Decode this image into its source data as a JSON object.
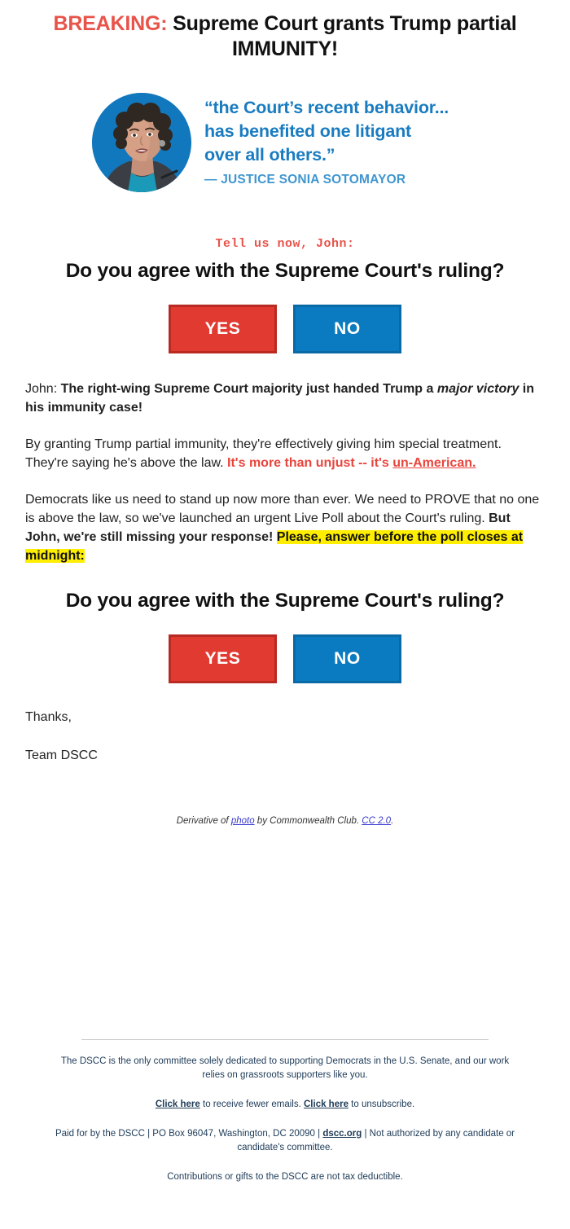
{
  "headline": {
    "breaking_label": "BREAKING:",
    "rest": " Supreme Court grants Trump partial IMMUNITY!"
  },
  "quote_card": {
    "portrait_alt": "Justice Sonia Sotomayor portrait",
    "lines": [
      "“the Court’s recent behavior...",
      "has benefited one litigant",
      "over all others.”"
    ],
    "attribution": "— JUSTICE SONIA SOTOMAYOR",
    "quote_color": "#1a7cc0",
    "attribution_color": "#3f96cf",
    "circle_color": "#1278be"
  },
  "poll": {
    "prompt": "Tell us now, John:",
    "question": "Do you agree with the Supreme Court's ruling?",
    "yes_label": "YES",
    "no_label": "NO",
    "yes_color": "#e03a31",
    "no_color": "#0a7bc0"
  },
  "body": {
    "p1_prefix": "John: ",
    "p1_bold_a": "The right-wing Supreme Court majority just handed Trump a ",
    "p1_italic": "major victory",
    "p1_bold_b": " in his immunity case!",
    "p2_plain": "By granting Trump partial immunity, they're effectively giving him special treatment. They're saying he's above the law. ",
    "p2_red_a": "It's more than unjust -- it's ",
    "p2_red_underline": "un-American.",
    "p3_plain": "Democrats like us need to stand up now more than ever. We need to PROVE that no one is above the law, so we've launched an urgent Live Poll about the Court's ruling. ",
    "p3_bold": "But John, we're still missing your response! ",
    "p3_highlight": "Please, answer before the poll closes at midnight:"
  },
  "signoff": {
    "line1": "Thanks,",
    "line2": "Team DSCC"
  },
  "photo_credit": {
    "prefix": "Derivative of ",
    "link_photo": "photo",
    "middle": " by Commonwealth Club. ",
    "link_license": "CC 2.0",
    "suffix": "."
  },
  "footer": {
    "mission": "The DSCC is the only committee solely dedicated to supporting Democrats in the U.S. Senate, and our work relies on grassroots supporters like you.",
    "fewer_link": "Click here",
    "fewer_rest": " to receive fewer emails. ",
    "unsub_link": "Click here",
    "unsub_rest": " to unsubscribe.",
    "paid_prefix": "Paid for by the DSCC | PO Box 96047, Washington, DC 20090 | ",
    "paid_link": "dscc.org",
    "paid_suffix": " | Not authorized by any candidate or candidate's committee.",
    "tax": "Contributions or gifts to the DSCC are not tax deductible."
  }
}
